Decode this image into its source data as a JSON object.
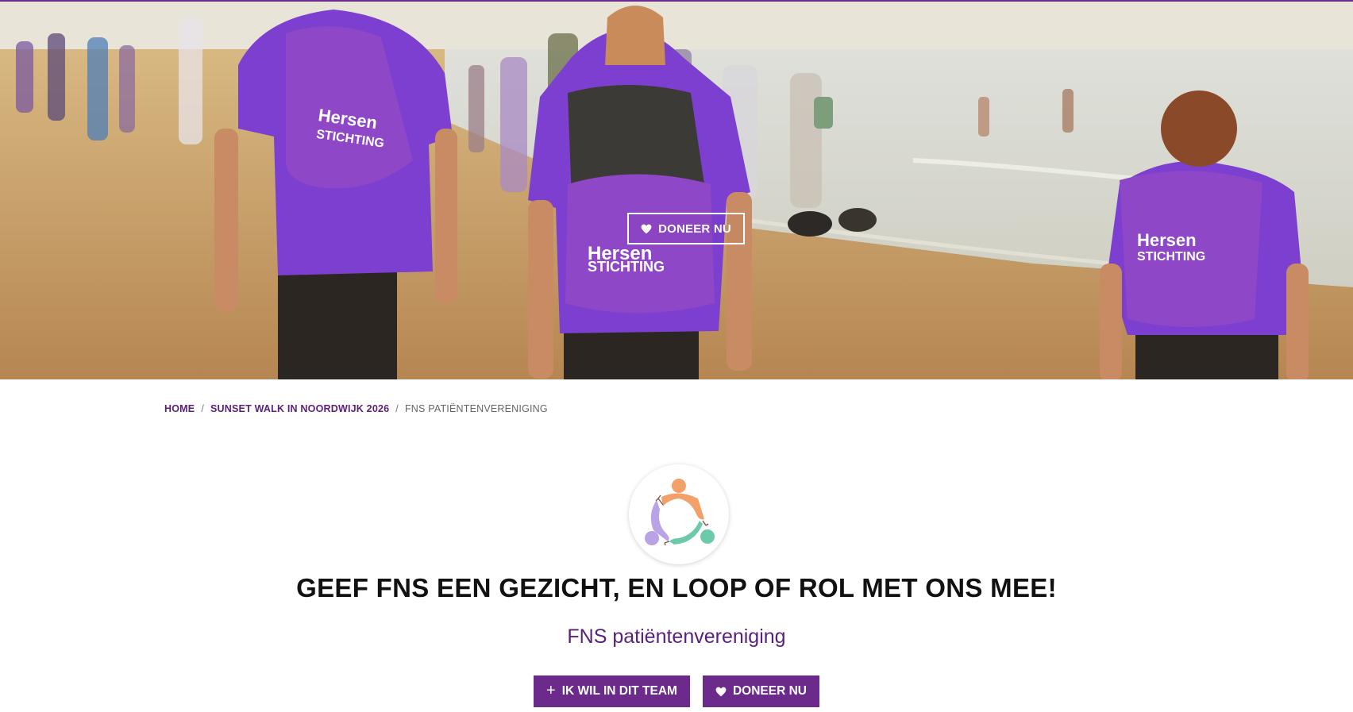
{
  "hero": {
    "donate_label": "DONEER NU",
    "bag_brand_line1": "Hersen",
    "bag_brand_line2": "STICHTING"
  },
  "breadcrumb": {
    "items": [
      {
        "label": "HOME"
      },
      {
        "label": "SUNSET WALK IN NOORDWIJK 2026"
      }
    ],
    "separator": "/",
    "current": "FNS PATIËNTENVERENIGING"
  },
  "team": {
    "title": "GEEF FNS EEN GEZICHT, EN LOOP OF ROL MET ONS MEE!",
    "subtitle": "FNS patiëntenvereniging"
  },
  "actions": {
    "join_label": "IK WIL IN DIT TEAM",
    "donate_label": "DONEER NU"
  },
  "colors": {
    "brand_purple": "#6b2a8c",
    "text_dark": "#111111"
  },
  "icons": {
    "heart": "heart-icon",
    "plus": "plus-icon",
    "team_logo": "team-logo"
  }
}
